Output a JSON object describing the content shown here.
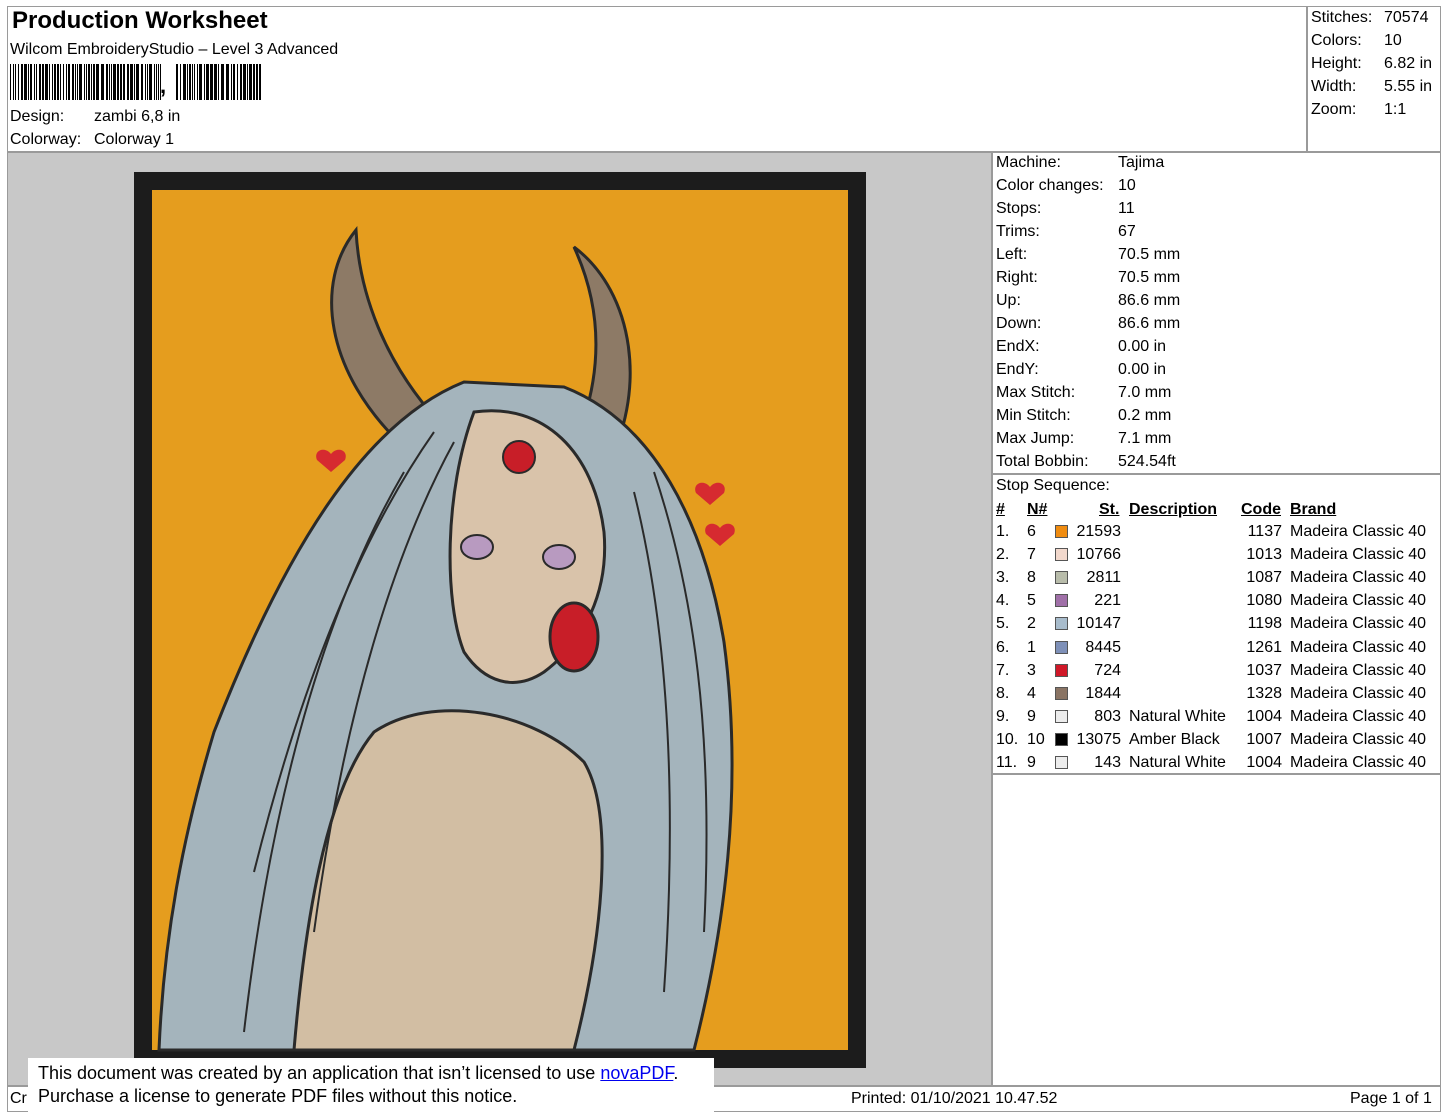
{
  "header": {
    "title": "Production Worksheet",
    "software": "Wilcom EmbroideryStudio – Level 3 Advanced",
    "design_label": "Design:",
    "design_value": "zambi 6,8 in",
    "colorway_label": "Colorway:",
    "colorway_value": "Colorway 1",
    "barcode_suffix": ","
  },
  "summary": [
    {
      "label": "Stitches:",
      "value": "70574"
    },
    {
      "label": "Colors:",
      "value": "10"
    },
    {
      "label": "Height:",
      "value": "6.82 in"
    },
    {
      "label": "Width:",
      "value": "5.55 in"
    },
    {
      "label": "Zoom:",
      "value": "1:1"
    }
  ],
  "machine_info": [
    {
      "label": "Machine:",
      "value": "Tajima"
    },
    {
      "label": "Color changes:",
      "value": "10"
    },
    {
      "label": "Stops:",
      "value": "11"
    },
    {
      "label": "Trims:",
      "value": "67"
    },
    {
      "label": "Left:",
      "value": "70.5 mm"
    },
    {
      "label": "Right:",
      "value": "70.5 mm"
    },
    {
      "label": "Up:",
      "value": "86.6 mm"
    },
    {
      "label": "Down:",
      "value": "86.6 mm"
    },
    {
      "label": "EndX:",
      "value": "0.00 in"
    },
    {
      "label": "EndY:",
      "value": "0.00 in"
    },
    {
      "label": "Max Stitch:",
      "value": "7.0 mm"
    },
    {
      "label": "Min Stitch:",
      "value": "0.2 mm"
    },
    {
      "label": "Max Jump:",
      "value": "7.1 mm"
    },
    {
      "label": "Total Bobbin:",
      "value": "524.54ft"
    }
  ],
  "stop_sequence": {
    "title": "Stop Sequence:",
    "headers": {
      "index": "#",
      "needle": "N#",
      "stitches": "St.",
      "description": "Description",
      "code": "Code",
      "brand": "Brand"
    },
    "rows": [
      {
        "index": "1.",
        "needle": "6",
        "color": "#f08c10",
        "stitches": "21593",
        "description": "",
        "code": "1137",
        "brand": "Madeira Classic 40"
      },
      {
        "index": "2.",
        "needle": "7",
        "color": "#f2d8cc",
        "stitches": "10766",
        "description": "",
        "code": "1013",
        "brand": "Madeira Classic 40"
      },
      {
        "index": "3.",
        "needle": "8",
        "color": "#b8bcaa",
        "stitches": "2811",
        "description": "",
        "code": "1087",
        "brand": "Madeira Classic 40"
      },
      {
        "index": "4.",
        "needle": "5",
        "color": "#a070a8",
        "stitches": "221",
        "description": "",
        "code": "1080",
        "brand": "Madeira Classic 40"
      },
      {
        "index": "5.",
        "needle": "2",
        "color": "#a8bccc",
        "stitches": "10147",
        "description": "",
        "code": "1198",
        "brand": "Madeira Classic 40"
      },
      {
        "index": "6.",
        "needle": "1",
        "color": "#7e90b8",
        "stitches": "8445",
        "description": "",
        "code": "1261",
        "brand": "Madeira Classic 40"
      },
      {
        "index": "7.",
        "needle": "3",
        "color": "#d01828",
        "stitches": "724",
        "description": "",
        "code": "1037",
        "brand": "Madeira Classic 40"
      },
      {
        "index": "8.",
        "needle": "4",
        "color": "#8a7464",
        "stitches": "1844",
        "description": "",
        "code": "1328",
        "brand": "Madeira Classic 40"
      },
      {
        "index": "9.",
        "needle": "9",
        "color": "#ececec",
        "stitches": "803",
        "description": "Natural White",
        "code": "1004",
        "brand": "Madeira Classic 40"
      },
      {
        "index": "10.",
        "needle": "10",
        "color": "#000000",
        "stitches": "13075",
        "description": "Amber Black",
        "code": "1007",
        "brand": "Madeira Classic 40"
      },
      {
        "index": "11.",
        "needle": "9",
        "color": "#ececec",
        "stitches": "143",
        "description": "Natural White",
        "code": "1004",
        "brand": "Madeira Classic 40"
      }
    ]
  },
  "footer": {
    "created_prefix": "Cr",
    "printed": "Printed: 01/10/2021 10.47.52",
    "page": "Page 1 of 1"
  },
  "notice": {
    "line1_text": "This document was created by an application that isn’t licensed to use ",
    "link": "novaPDF",
    "line1_end": ".",
    "line2": "Purchase a license to generate PDF files without this notice."
  },
  "colors": {
    "background": "#e59d1e",
    "frame": "#1c1c1c",
    "hair": "#a4b4bc",
    "skin": "#d9c3aa",
    "horn": "#8d7a66",
    "heart": "#d62a30"
  }
}
